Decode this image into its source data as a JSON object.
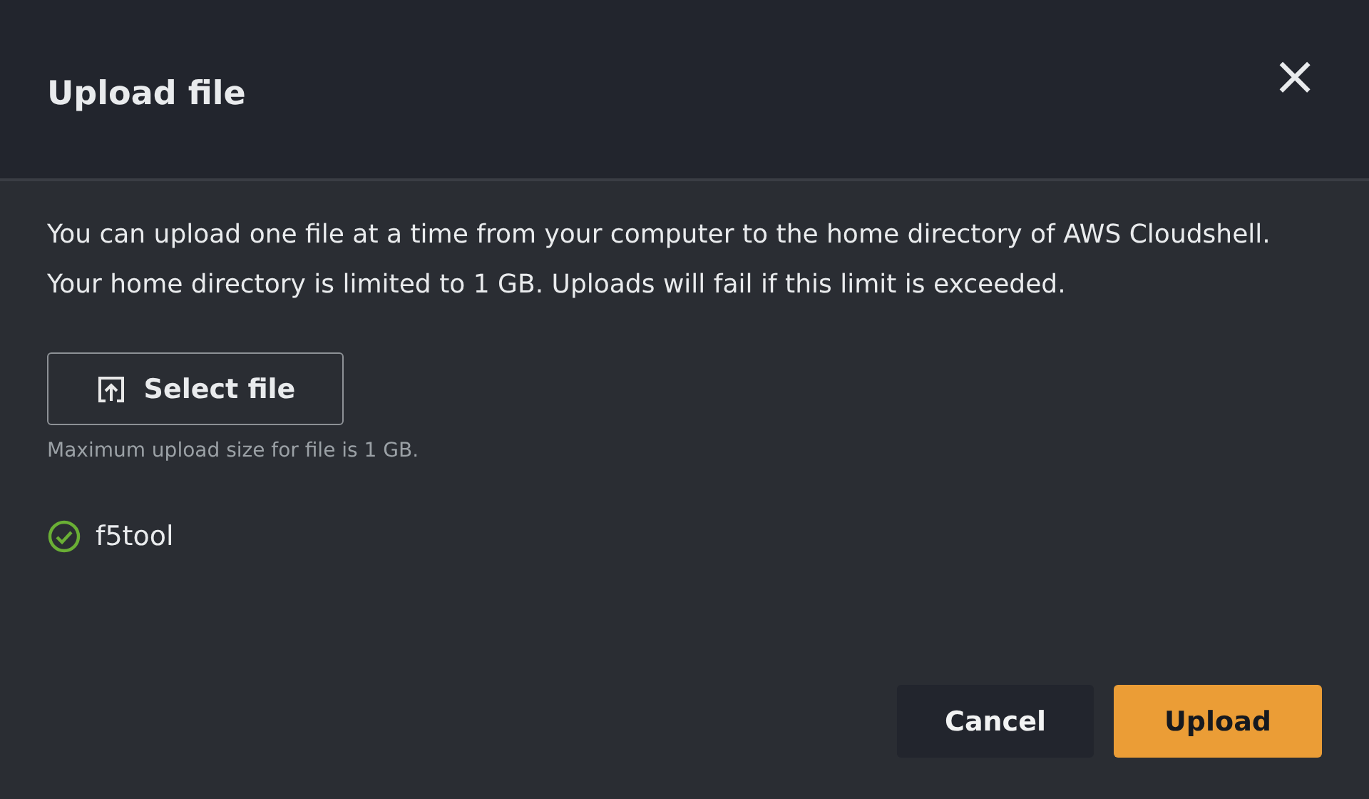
{
  "dialog": {
    "title": "Upload file",
    "close": "×"
  },
  "description": "You can upload one file at a time from your computer to the home directory of AWS Cloudshell. Your home directory is limited to 1 GB. Uploads will fail if this limit is exceeded.",
  "select_button": "Select file",
  "hint": "Maximum upload size for file is 1 GB.",
  "files": [
    {
      "name": "f5tool",
      "kind": "success"
    }
  ],
  "buttons": [
    {
      "label": "Cancel",
      "kind": "secondary"
    },
    {
      "label": "Upload",
      "kind": "primary"
    }
  ]
}
